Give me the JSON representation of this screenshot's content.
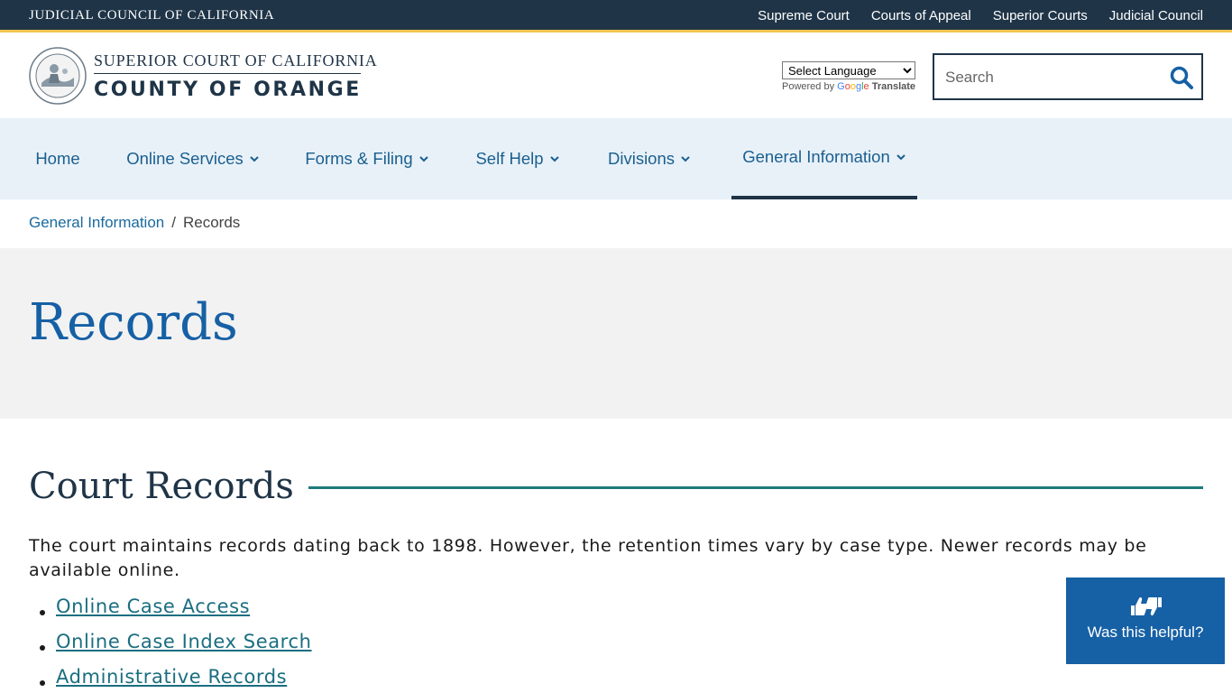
{
  "topbar": {
    "brand": "JUDICIAL COUNCIL OF CALIFORNIA",
    "links": [
      "Supreme Court",
      "Courts of Appeal",
      "Superior Courts",
      "Judicial Council"
    ]
  },
  "header": {
    "logo_line1": "SUPERIOR COURT OF CALIFORNIA",
    "logo_line2": "COUNTY OF ORANGE",
    "language_select": "Select Language",
    "powered_by": "Powered by",
    "google": [
      "G",
      "o",
      "o",
      "g",
      "l",
      "e"
    ],
    "translate": "Translate",
    "search_placeholder": "Search"
  },
  "nav": {
    "items": [
      {
        "label": "Home",
        "has_dropdown": false
      },
      {
        "label": "Online Services",
        "has_dropdown": true
      },
      {
        "label": "Forms & Filing",
        "has_dropdown": true
      },
      {
        "label": "Self Help",
        "has_dropdown": true
      },
      {
        "label": "Divisions",
        "has_dropdown": true
      },
      {
        "label": "General Information",
        "has_dropdown": true,
        "active": true
      }
    ]
  },
  "breadcrumb": {
    "parent": "General Information",
    "separator": "/",
    "current": "Records"
  },
  "page": {
    "title": "Records",
    "section_title": "Court Records",
    "paragraph": "The court maintains records dating back to 1898. However, the retention times vary by case type. Newer records may be available online.",
    "links": [
      "Online Case Access",
      "Online Case Index Search",
      "Administrative Records"
    ]
  },
  "feedback": {
    "label": "Was this helpful?"
  },
  "colors": {
    "topbar": "#1f3447",
    "accent_gold": "#f4c451",
    "nav_bg": "#e8f1f8",
    "link_blue": "#1a6a9e",
    "title_blue": "#1660a5",
    "teal_rule": "#1f7a7a"
  }
}
